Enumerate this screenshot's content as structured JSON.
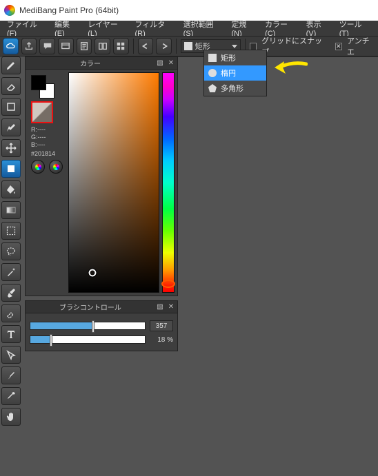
{
  "title": "MediBang Paint Pro (64bit)",
  "menu": {
    "file": "ファイル(F)",
    "edit": "編集(E)",
    "layer": "レイヤー(L)",
    "filter": "フィルタ(R)",
    "select": "選択範囲(S)",
    "ruler": "定規(N)",
    "color": "カラー(C)",
    "view": "表示(V)",
    "tool": "ツール(T)"
  },
  "shape": {
    "current": "矩形",
    "options": [
      "矩形",
      "楕円",
      "多角形"
    ],
    "selected_index": 1
  },
  "opts": {
    "snap_grid": "グリッドにスナップ",
    "antialias": "アンチエ"
  },
  "color_panel": {
    "title": "カラー",
    "rgb": {
      "r": "R:----",
      "g": "G:----",
      "b": "B:----"
    },
    "hex": "#201814"
  },
  "brush_panel": {
    "title": "ブラシコントロール",
    "size": {
      "value": "357",
      "pct": 55
    },
    "opacity": {
      "value": "18 %",
      "pct": 18
    }
  }
}
